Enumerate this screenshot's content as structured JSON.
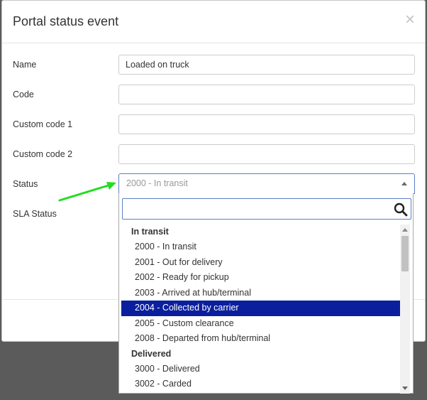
{
  "modal": {
    "title": "Portal status event",
    "close_glyph": "×"
  },
  "form": {
    "name_label": "Name",
    "name_value": "Loaded on truck",
    "code_label": "Code",
    "code_value": "",
    "custom1_label": "Custom code 1",
    "custom1_value": "",
    "custom2_label": "Custom code 2",
    "custom2_value": "",
    "status_label": "Status",
    "status_value": "2000 - In transit",
    "sla_label": "SLA Status"
  },
  "dropdown": {
    "search_value": "",
    "groups": [
      {
        "label": "In transit",
        "options": [
          "2000 - In transit",
          "2001 - Out for delivery",
          "2002 - Ready for pickup",
          "2003 - Arrived at hub/terminal",
          "2004 - Collected by carrier",
          "2005 - Custom clearance",
          "2008 - Departed from hub/terminal"
        ]
      },
      {
        "label": "Delivered",
        "options": [
          "3000 - Delivered",
          "3002 - Carded"
        ]
      }
    ],
    "highlighted": "2004 - Collected by carrier"
  },
  "colors": {
    "highlight": "#0b1f9e",
    "arrow": "#22dd22",
    "focus_border": "#5a7fc6"
  }
}
